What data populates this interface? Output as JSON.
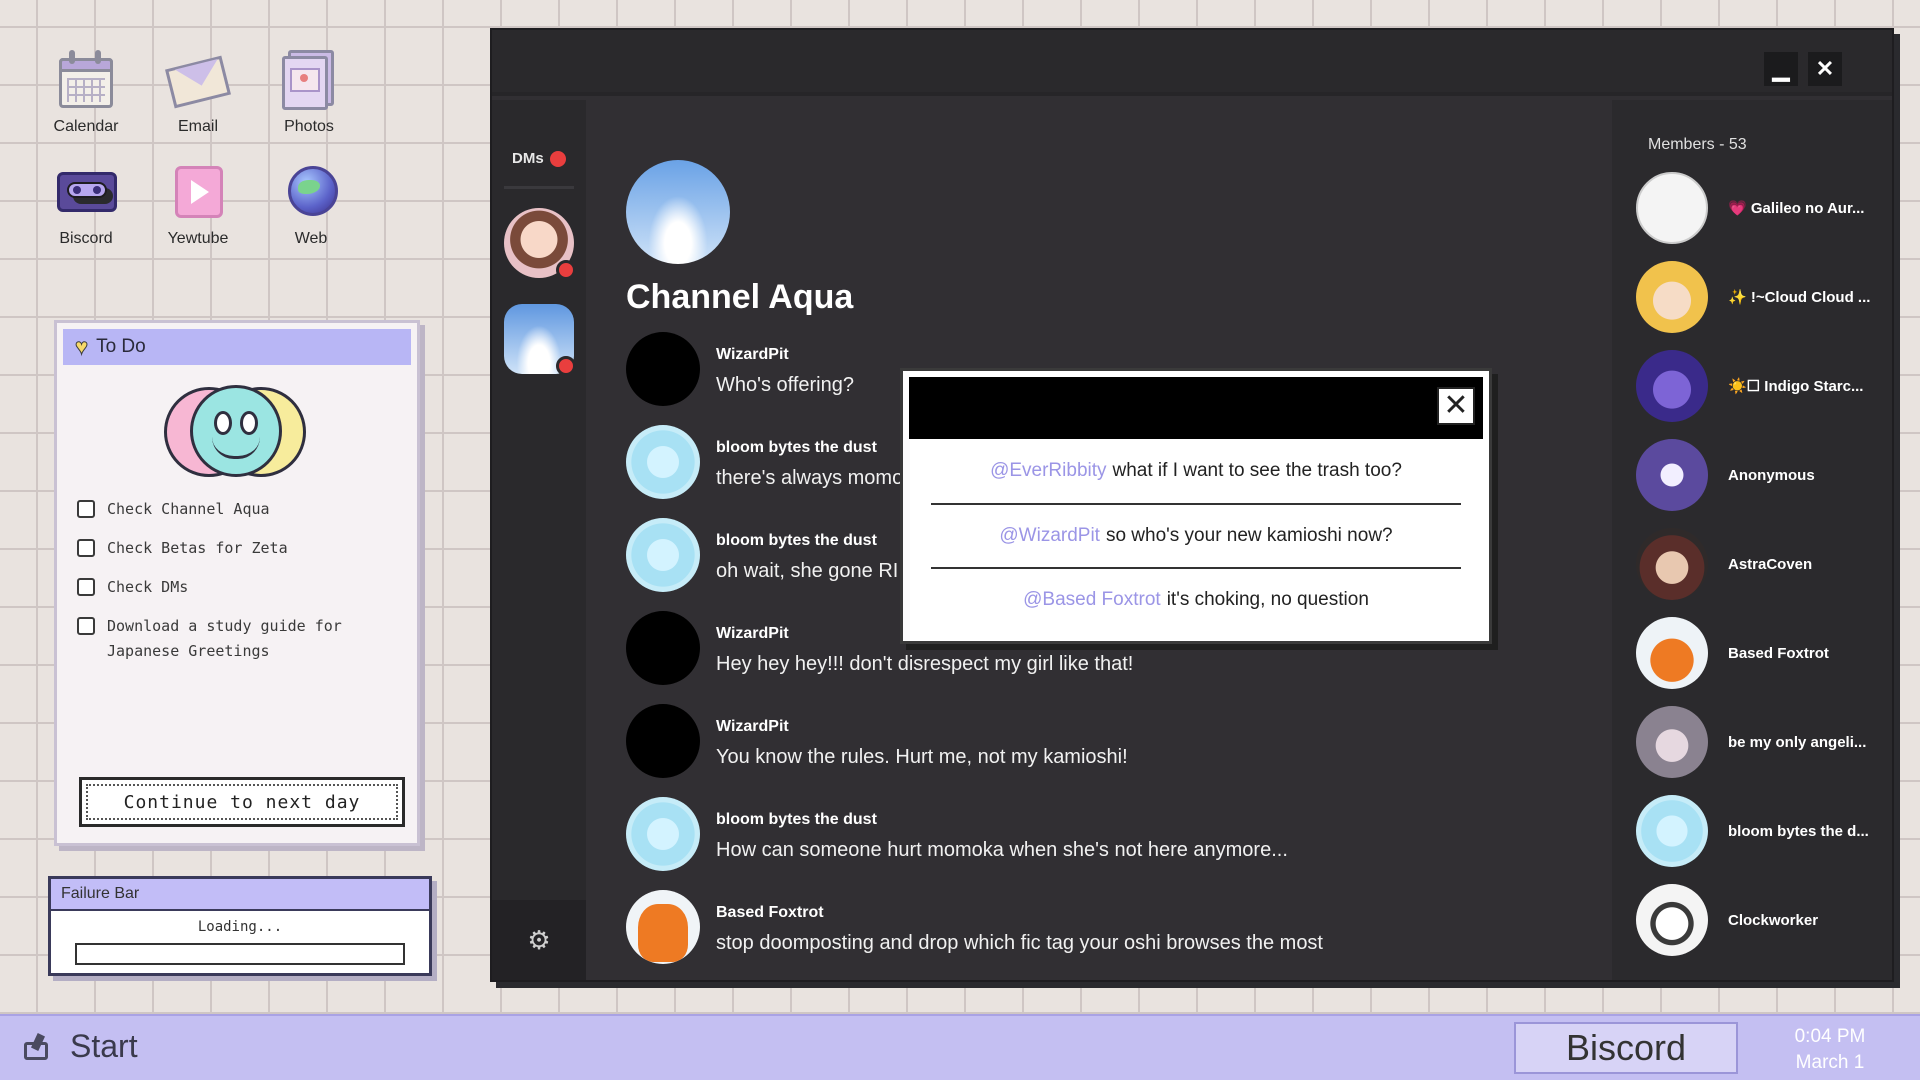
{
  "desktop": {
    "icons": [
      {
        "label": "Calendar",
        "icon": "calendar-icon"
      },
      {
        "label": "Email",
        "icon": "envelope-icon"
      },
      {
        "label": "Photos",
        "icon": "photos-icon"
      },
      {
        "label": "Biscord",
        "icon": "biscord-cassette-icon"
      },
      {
        "label": "Yewtube",
        "icon": "play-icon"
      },
      {
        "label": "Web",
        "icon": "globe-icon"
      }
    ]
  },
  "todo": {
    "title": "To Do",
    "items": [
      "Check Channel Aqua",
      "Check Betas for Zeta",
      "Check DMs",
      "Download a study guide for Japanese Greetings"
    ],
    "continue_label": "Continue to next day"
  },
  "failure_bar": {
    "title": "Failure Bar",
    "status": "Loading...",
    "progress": 0
  },
  "biscord": {
    "dms_label": "DMs",
    "channel_title": "Channel Aqua",
    "messages": [
      {
        "author": "WizardPit",
        "text": "Who's offering?",
        "avatar": "black"
      },
      {
        "author": "bloom bytes the dust",
        "text": "there's always momo",
        "avatar": "bloom"
      },
      {
        "author": "bloom bytes the dust",
        "text": "oh wait, she gone RI",
        "avatar": "bloom"
      },
      {
        "author": "WizardPit",
        "text": "Hey hey hey!!! don't disrespect my girl like that!",
        "avatar": "black"
      },
      {
        "author": "WizardPit",
        "text": "You know the rules. Hurt me, not my kamioshi!",
        "avatar": "black"
      },
      {
        "author": "bloom bytes the dust",
        "text": "How can someone hurt momoka when she's not here anymore...",
        "avatar": "bloom"
      },
      {
        "author": "Based Foxtrot",
        "text": "stop doomposting and drop which fic tag your oshi browses the most",
        "avatar": "fox"
      }
    ],
    "members_header": "Members - 53",
    "members": [
      {
        "name": "💗 Galileo no Aur..."
      },
      {
        "name": "✨ !~Cloud Cloud ..."
      },
      {
        "name": "☀️☐ Indigo Starc..."
      },
      {
        "name": "Anonymous"
      },
      {
        "name": "AstraCoven"
      },
      {
        "name": "Based Foxtrot"
      },
      {
        "name": "be my only angeli..."
      },
      {
        "name": "bloom bytes the d..."
      },
      {
        "name": "Clockworker"
      }
    ]
  },
  "reply_popup": {
    "options": [
      {
        "mention": "@EverRibbity",
        "text": "what if I want to see the trash too?"
      },
      {
        "mention": "@WizardPit",
        "text": "so who's your new kamioshi now?"
      },
      {
        "mention": "@Based Foxtrot",
        "text": "it's choking, no question"
      }
    ]
  },
  "taskbar": {
    "start_label": "Start",
    "active_app": "Biscord",
    "time": "0:04 PM",
    "date": "March 1"
  },
  "colors": {
    "accent": "#c4bff2",
    "mention": "#9b95e6",
    "notification": "#e93e3e"
  }
}
